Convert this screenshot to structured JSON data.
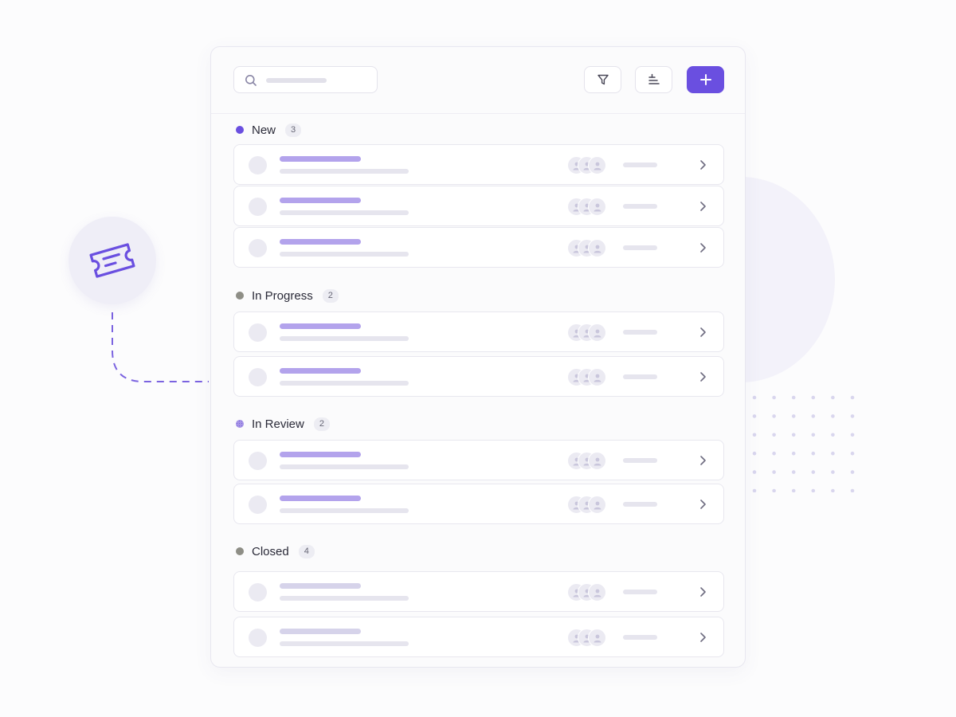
{
  "theme": {
    "accent": "#6a4fe0",
    "status_colors": {
      "new": "#6a4fe0",
      "in_progress": "#8e8e86",
      "in_review": "#8f7ad8",
      "closed": "#8e8e86"
    }
  },
  "decor": {
    "ticket_icon": "ticket-icon"
  },
  "toolbar": {
    "search_icon": "search-icon",
    "filter_icon": "filter-icon",
    "sort_icon": "sort-icon",
    "add_icon": "plus-icon"
  },
  "groups": [
    {
      "label": "New",
      "count": "3",
      "status": "new"
    },
    {
      "label": "In Progress",
      "count": "2",
      "status": "in_progress"
    },
    {
      "label": "In Review",
      "count": "2",
      "status": "in_review"
    },
    {
      "label": "Closed",
      "count": "4",
      "status": "closed"
    }
  ]
}
